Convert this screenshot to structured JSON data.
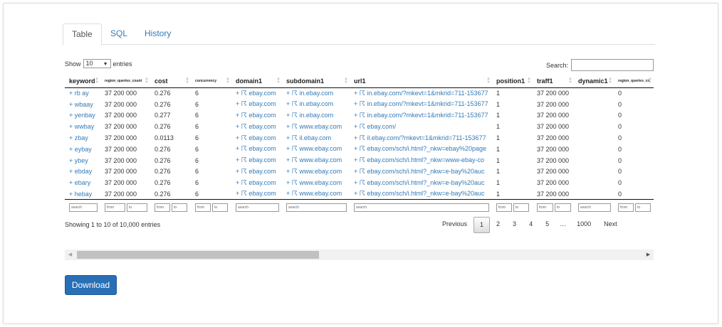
{
  "tabs": [
    {
      "label": "Table"
    },
    {
      "label": "SQL"
    },
    {
      "label": "History"
    }
  ],
  "controls": {
    "show_label": "Show",
    "entries_value": "10",
    "entries_label": "entries",
    "search_label": "Search:"
  },
  "table": {
    "columns": [
      {
        "label": "keyword"
      },
      {
        "label": "region_queries_count"
      },
      {
        "label": "cost"
      },
      {
        "label": "concurrency"
      },
      {
        "label": "domain1"
      },
      {
        "label": "subdomain1"
      },
      {
        "label": "url1"
      },
      {
        "label": "position1"
      },
      {
        "label": "traff1"
      },
      {
        "label": "dynamic1"
      },
      {
        "label": "region_queries_co"
      }
    ],
    "rows": [
      {
        "keyword": "+ rb ay",
        "region_queries_count": "37 200 000",
        "cost": "0.276",
        "concurrency": "6",
        "domain1": "+ ☈ ebay.com",
        "subdomain1": "+ ☈ in.ebay.com",
        "url1": "+ ☈ in.ebay.com/?mkevt=1&mkrid=711-153677",
        "position1": "1",
        "traff1": "37 200 000",
        "dynamic1": "",
        "region_queries_co": "0"
      },
      {
        "keyword": "+ wbaay",
        "region_queries_count": "37 200 000",
        "cost": "0.276",
        "concurrency": "6",
        "domain1": "+ ☈ ebay.com",
        "subdomain1": "+ ☈ in.ebay.com",
        "url1": "+ ☈ in.ebay.com/?mkevt=1&mkrid=711-153677",
        "position1": "1",
        "traff1": "37 200 000",
        "dynamic1": "",
        "region_queries_co": "0"
      },
      {
        "keyword": "+ yenbay",
        "region_queries_count": "37 200 000",
        "cost": "0.277",
        "concurrency": "6",
        "domain1": "+ ☈ ebay.com",
        "subdomain1": "+ ☈ in.ebay.com",
        "url1": "+ ☈ in.ebay.com/?mkevt=1&mkrid=711-153677",
        "position1": "1",
        "traff1": "37 200 000",
        "dynamic1": "",
        "region_queries_co": "0"
      },
      {
        "keyword": "+ wwbay",
        "region_queries_count": "37 200 000",
        "cost": "0.276",
        "concurrency": "6",
        "domain1": "+ ☈ ebay.com",
        "subdomain1": "+ ☈ www.ebay.com",
        "url1": "+ ☈ ebay.com/",
        "position1": "1",
        "traff1": "37 200 000",
        "dynamic1": "",
        "region_queries_co": "0"
      },
      {
        "keyword": "+ zbay",
        "region_queries_count": "37 200 000",
        "cost": "0.0113",
        "concurrency": "6",
        "domain1": "+ ☈ ebay.com",
        "subdomain1": "+ ☈ il.ebay.com",
        "url1": "+ ☈ il.ebay.com/?mkevt=1&mkrid=711-153677",
        "position1": "1",
        "traff1": "37 200 000",
        "dynamic1": "",
        "region_queries_co": "0"
      },
      {
        "keyword": "+ eybay",
        "region_queries_count": "37 200 000",
        "cost": "0.276",
        "concurrency": "6",
        "domain1": "+ ☈ ebay.com",
        "subdomain1": "+ ☈ www.ebay.com",
        "url1": "+ ☈ ebay.com/sch/i.html?_nkw=ebay%20page",
        "position1": "1",
        "traff1": "37 200 000",
        "dynamic1": "",
        "region_queries_co": "0"
      },
      {
        "keyword": "+ ybey",
        "region_queries_count": "37 200 000",
        "cost": "0.276",
        "concurrency": "6",
        "domain1": "+ ☈ ebay.com",
        "subdomain1": "+ ☈ www.ebay.com",
        "url1": "+ ☈ ebay.com/sch/i.html?_nkw=www-ebay-co",
        "position1": "1",
        "traff1": "37 200 000",
        "dynamic1": "",
        "region_queries_co": "0"
      },
      {
        "keyword": "+ ebday",
        "region_queries_count": "37 200 000",
        "cost": "0.276",
        "concurrency": "6",
        "domain1": "+ ☈ ebay.com",
        "subdomain1": "+ ☈ www.ebay.com",
        "url1": "+ ☈ ebay.com/sch/i.html?_nkw=e-bay%20auc",
        "position1": "1",
        "traff1": "37 200 000",
        "dynamic1": "",
        "region_queries_co": "0"
      },
      {
        "keyword": "+ ebary",
        "region_queries_count": "37 200 000",
        "cost": "0.276",
        "concurrency": "6",
        "domain1": "+ ☈ ebay.com",
        "subdomain1": "+ ☈ www.ebay.com",
        "url1": "+ ☈ ebay.com/sch/i.html?_nkw=e-bay%20auc",
        "position1": "1",
        "traff1": "37 200 000",
        "dynamic1": "",
        "region_queries_co": "0"
      },
      {
        "keyword": "+ hebay",
        "region_queries_count": "37 200 000",
        "cost": "0.276",
        "concurrency": "6",
        "domain1": "+ ☈ ebay.com",
        "subdomain1": "+ ☈ www.ebay.com",
        "url1": "+ ☈ ebay.com/sch/i.html?_nkw=e-bay%20auc",
        "position1": "1",
        "traff1": "37 200 000",
        "dynamic1": "",
        "region_queries_co": "0"
      }
    ],
    "filters": [
      {
        "type": "search",
        "placeholders": [
          "search"
        ]
      },
      {
        "type": "range",
        "placeholders": [
          "from",
          "to"
        ]
      },
      {
        "type": "range",
        "placeholders": [
          "from",
          "to"
        ]
      },
      {
        "type": "range",
        "placeholders": [
          "from",
          "to"
        ]
      },
      {
        "type": "search",
        "placeholders": [
          "search"
        ]
      },
      {
        "type": "search",
        "placeholders": [
          "search"
        ]
      },
      {
        "type": "search",
        "placeholders": [
          "search"
        ]
      },
      {
        "type": "range",
        "placeholders": [
          "from",
          "to"
        ]
      },
      {
        "type": "range",
        "placeholders": [
          "from",
          "to"
        ]
      },
      {
        "type": "search",
        "placeholders": [
          "search"
        ]
      },
      {
        "type": "range",
        "placeholders": [
          "from",
          "to"
        ]
      }
    ]
  },
  "info": "Showing 1 to 10 of 10,000 entries",
  "pagination": {
    "previous": "Previous",
    "pages": [
      "1",
      "2",
      "3",
      "4",
      "5",
      "…",
      "1000"
    ],
    "current": "1",
    "next": "Next"
  },
  "download_label": "Download",
  "icons": {
    "sort": "sort-both-icon",
    "dropdown": "chevron-down-icon",
    "scroll_left": "triangle-left-icon",
    "scroll_right": "triangle-right-icon"
  }
}
